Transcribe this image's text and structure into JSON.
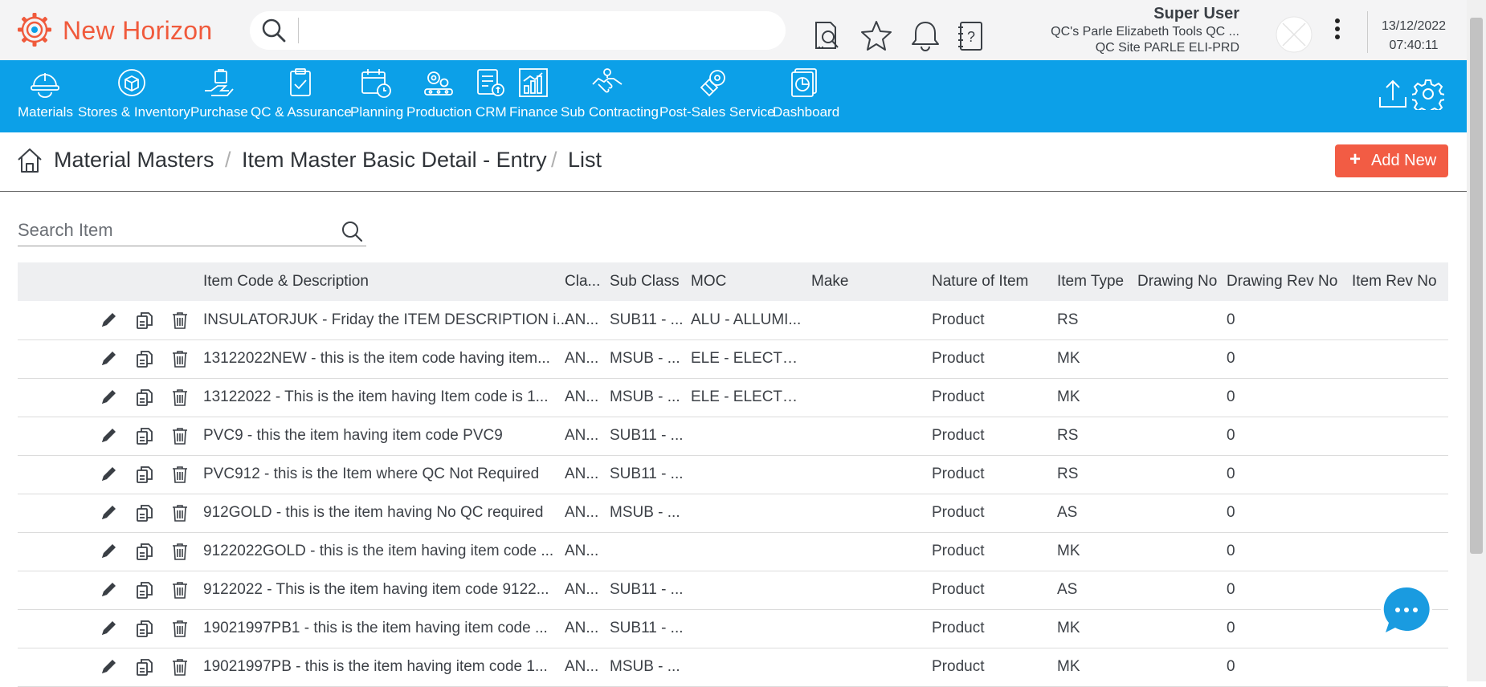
{
  "app": {
    "name": "New Horizon",
    "brand_color": "#f05a3c",
    "accent_color": "#0ca0e8",
    "logo_icon": "gear-logo-icon"
  },
  "header": {
    "search_placeholder": "",
    "icons": [
      "report-search-icon",
      "star-icon",
      "bell-icon",
      "help-book-icon"
    ],
    "user": {
      "name": "Super User",
      "company": "QC's Parle Elizabeth Tools QC ...",
      "site": "QC Site PARLE ELI-PRD"
    },
    "date": "13/12/2022",
    "time": "07:40:11"
  },
  "modules": [
    {
      "label": "Materials",
      "icon": "helmet-icon"
    },
    {
      "label": "Stores & Inventory",
      "icon": "box-cycle-icon"
    },
    {
      "label": "Purchase",
      "icon": "hand-bag-icon"
    },
    {
      "label": "QC & Assurance",
      "icon": "clipboard-check-icon"
    },
    {
      "label": "Planning",
      "icon": "calendar-clock-icon"
    },
    {
      "label": "Production",
      "icon": "gear-conveyor-icon"
    },
    {
      "label": "CRM",
      "icon": "crm-card-icon"
    },
    {
      "label": "Finance",
      "icon": "bar-chart-icon"
    },
    {
      "label": "Sub Contracting",
      "icon": "handshake-icon"
    },
    {
      "label": "Post-Sales Service",
      "icon": "service-gear-icon"
    },
    {
      "label": "Dashboard",
      "icon": "dashboard-pie-icon"
    }
  ],
  "breadcrumb": {
    "items": [
      "Material Masters",
      "Item Master Basic Detail - Entry",
      "List"
    ],
    "separator": "/"
  },
  "actions": {
    "add_new_label": "Add New",
    "add_new_color": "#f25c44"
  },
  "item_search": {
    "placeholder": "Search Item"
  },
  "table": {
    "columns": [
      "Item Code & Description",
      "Cla...",
      "Sub Class",
      "MOC",
      "Make",
      "Nature of Item",
      "Item Type",
      "Drawing No",
      "Drawing Rev No",
      "Item Rev No"
    ],
    "rows": [
      {
        "desc": "INSULATORJUK - Friday the ITEM DESCRIPTION i...",
        "cls": "AN...",
        "sub": "SUB11 - ...",
        "moc": "ALU - ALLUMI...",
        "make": "",
        "nature": "Product",
        "type": "RS",
        "drawing": "",
        "drev": "0",
        "irev": ""
      },
      {
        "desc": "13122022NEW - this is the item code having item...",
        "cls": "AN...",
        "sub": "MSUB - ...",
        "moc": "ELE - ELECTRI...",
        "make": "",
        "nature": "Product",
        "type": "MK",
        "drawing": "",
        "drev": "0",
        "irev": ""
      },
      {
        "desc": "13122022 - This is the item having Item code is 1...",
        "cls": "AN...",
        "sub": "MSUB - ...",
        "moc": "ELE - ELECTRI...",
        "make": "",
        "nature": "Product",
        "type": "MK",
        "drawing": "",
        "drev": "0",
        "irev": ""
      },
      {
        "desc": "PVC9 - this the item having item code PVC9",
        "cls": "AN...",
        "sub": "SUB11 - ...",
        "moc": "",
        "make": "",
        "nature": "Product",
        "type": "RS",
        "drawing": "",
        "drev": "0",
        "irev": ""
      },
      {
        "desc": "PVC912 - this is the Item where QC Not Required",
        "cls": "AN...",
        "sub": "SUB11 - ...",
        "moc": "",
        "make": "",
        "nature": "Product",
        "type": "RS",
        "drawing": "",
        "drev": "0",
        "irev": ""
      },
      {
        "desc": "912GOLD - this is the item having No QC required",
        "cls": "AN...",
        "sub": "MSUB - ...",
        "moc": "",
        "make": "",
        "nature": "Product",
        "type": "AS",
        "drawing": "",
        "drev": "0",
        "irev": ""
      },
      {
        "desc": "9122022GOLD - this is the item having item code ...",
        "cls": "AN...",
        "sub": "",
        "moc": "",
        "make": "",
        "nature": "Product",
        "type": "MK",
        "drawing": "",
        "drev": "0",
        "irev": ""
      },
      {
        "desc": "9122022 - This is the item having item code 9122...",
        "cls": "AN...",
        "sub": "SUB11 - ...",
        "moc": "",
        "make": "",
        "nature": "Product",
        "type": "AS",
        "drawing": "",
        "drev": "0",
        "irev": ""
      },
      {
        "desc": "19021997PB1 - this is the item having item code ...",
        "cls": "AN...",
        "sub": "SUB11 - ...",
        "moc": "",
        "make": "",
        "nature": "Product",
        "type": "MK",
        "drawing": "",
        "drev": "0",
        "irev": ""
      },
      {
        "desc": "19021997PB - this is the item having item code 1...",
        "cls": "AN...",
        "sub": "MSUB - ...",
        "moc": "",
        "make": "",
        "nature": "Product",
        "type": "MK",
        "drawing": "",
        "drev": "0",
        "irev": ""
      }
    ],
    "row_actions": [
      "edit-pencil-icon",
      "copy-icon",
      "delete-trash-icon"
    ]
  },
  "chat": {
    "icon": "chat-bubble-icon"
  }
}
